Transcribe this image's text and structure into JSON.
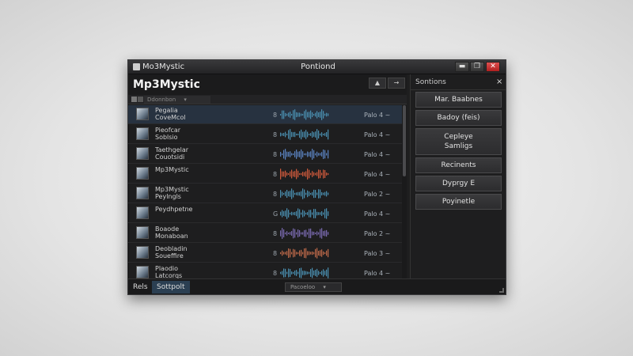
{
  "window": {
    "app_name": "Mo3Mystic",
    "tab_title": "Pontiond",
    "controls": {
      "minimize": "▬",
      "maximize": "❐",
      "close": "✕"
    }
  },
  "header": {
    "title": "Mp3Mystic",
    "nav_up": "▲",
    "nav_next": "→"
  },
  "toolbar": {
    "filter_label": "Ddonnbon",
    "filter_arrow": "▾"
  },
  "tracks": [
    {
      "title": "Pegalia\nCoveMcol",
      "num": "8",
      "status": "Palo 4 ~",
      "wave_color": "#4a8fb0",
      "selected": true
    },
    {
      "title": "Pieofcar\nSoblsio",
      "num": "8",
      "status": "Palo 4 ~",
      "wave_color": "#4a8fb0",
      "selected": false
    },
    {
      "title": "Taethgelar\nCouotsidi",
      "num": "8",
      "status": "Palo 4 ~",
      "wave_color": "#5a82c0",
      "selected": false
    },
    {
      "title": "Mp3Mystic",
      "num": "8",
      "status": "Palo 4 ~",
      "wave_color": "#d05a3c",
      "selected": false
    },
    {
      "title": "Mp3Mystic\nPeylngls",
      "num": "8",
      "status": "Palo 2 ~",
      "wave_color": "#4a8fb0",
      "selected": false
    },
    {
      "title": "Peydhpetne",
      "num": "G",
      "status": "Palo 4 ~",
      "wave_color": "#4a8fb0",
      "selected": false
    },
    {
      "title": "Boaode\nMonaboan",
      "num": "8",
      "status": "Palo 2 ~",
      "wave_color": "#7a6ab0",
      "selected": false
    },
    {
      "title": "Deobladin\nSoueffire",
      "num": "8",
      "status": "Palo 3 ~",
      "wave_color": "#c06a4a",
      "selected": false
    },
    {
      "title": "Plaodio\nLatcorqs",
      "num": "8",
      "status": "Palo 4 ~",
      "wave_color": "#4a8fb0",
      "selected": false
    }
  ],
  "statusbar": {
    "left": "Rels",
    "active": "Sottpolt",
    "select_label": "Pacoeloo",
    "select_arrow": "▾"
  },
  "sidebar": {
    "title": "Sontions",
    "close": "×",
    "buttons": [
      "Mar. Baabnes",
      "Badoy (feis)",
      "Cepleye\nSamligs",
      "Recinents",
      "Dyprgy E",
      "Poyinetle"
    ]
  }
}
